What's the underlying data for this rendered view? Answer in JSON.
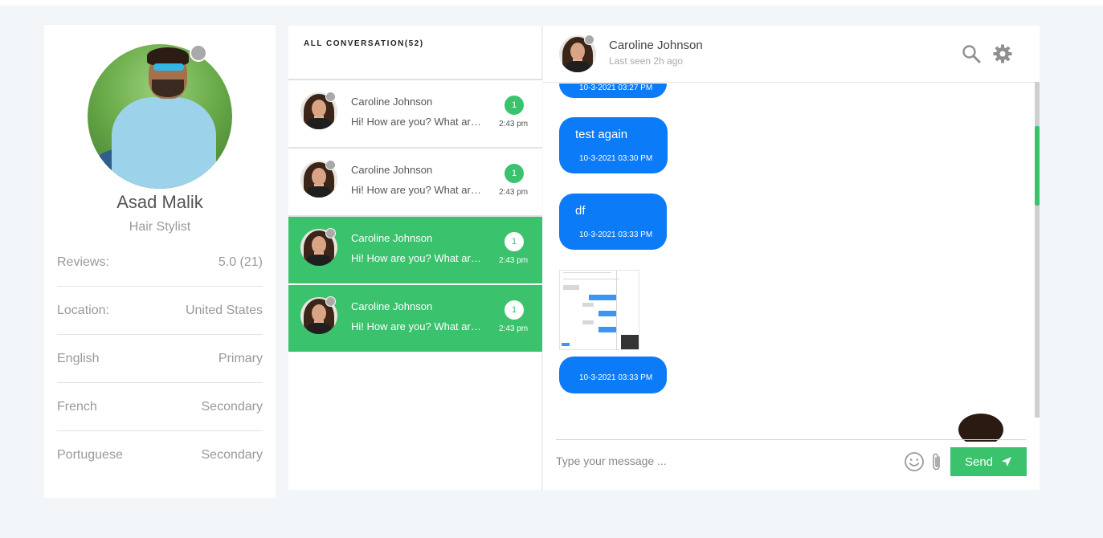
{
  "colors": {
    "accent": "#3bc26d",
    "bubble": "#0b7bf7",
    "status_offline": "#a9a9a9"
  },
  "profile": {
    "name": "Asad Malik",
    "role": "Hair Stylist",
    "rows": [
      {
        "label": "Reviews:",
        "value": "5.0 (21)"
      },
      {
        "label": "Location:",
        "value": "United States"
      },
      {
        "label": "English",
        "value": "Primary"
      },
      {
        "label": "French",
        "value": "Secondary"
      },
      {
        "label": "Portuguese",
        "value": "Secondary"
      }
    ]
  },
  "conversations": {
    "title": "ALL CONVERSATION(52)",
    "items": [
      {
        "name": "Caroline Johnson",
        "preview": "Hi! How are you? What are you doing?",
        "badge": "1",
        "time": "2:43 pm",
        "active": false
      },
      {
        "name": "Caroline Johnson",
        "preview": "Hi! How are you? What are you doing?",
        "badge": "1",
        "time": "2:43 pm",
        "active": false
      },
      {
        "name": "Caroline Johnson",
        "preview": "Hi! How are you? What are you doing?",
        "badge": "1",
        "time": "2:43 pm",
        "active": true
      },
      {
        "name": "Caroline Johnson",
        "preview": "Hi! How are you? What are you doing?",
        "badge": "1",
        "time": "2:43 pm",
        "active": true
      }
    ]
  },
  "chat": {
    "contact_name": "Caroline Johnson",
    "last_seen": "Last seen 2h ago",
    "icons": [
      "search-icon",
      "gear-icon",
      "emoji-icon",
      "paperclip-icon",
      "send-icon"
    ],
    "messages": [
      {
        "text": "",
        "time": "10-3-2021 03:27 PM"
      },
      {
        "text": "test again",
        "time": "10-3-2021 03:30 PM"
      },
      {
        "text": "df",
        "time": "10-3-2021 03:33 PM"
      },
      {
        "text": "",
        "time": "10-3-2021 03:33 PM"
      }
    ],
    "composer": {
      "placeholder": "Type your message ...",
      "send_label": "Send"
    }
  }
}
